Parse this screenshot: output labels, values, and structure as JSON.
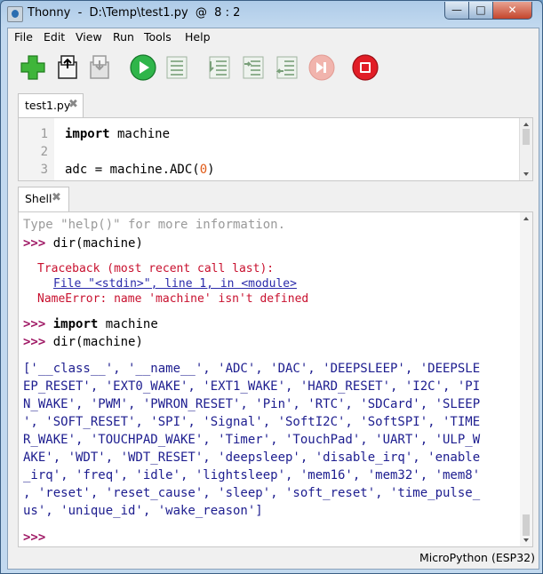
{
  "window": {
    "title": "Thonny  -  D:\\Temp\\test1.py  @  8 : 2"
  },
  "menu": [
    "File",
    "Edit",
    "View",
    "Run",
    "Tools",
    "Help"
  ],
  "toolbar": {
    "buttons": [
      "new-file",
      "open-file",
      "save-file",
      "run",
      "debug",
      "step-over",
      "step-into",
      "step-out",
      "resume",
      "stop"
    ]
  },
  "editor": {
    "tab": "test1.py",
    "lines": [
      {
        "n": "1",
        "kw": "import",
        "rest": " machine"
      },
      {
        "n": "2",
        "kw": "",
        "rest": ""
      },
      {
        "n": "3",
        "pre": "adc = machine.ADC(",
        "num": "0",
        "post": ")"
      }
    ]
  },
  "shell": {
    "tab": "Shell",
    "help_line": "Type \"help()\" for more information.",
    "prompt": ">>>",
    "cmd1": " dir(machine)",
    "traceback": "Traceback (most recent call last):",
    "file_line": "File \"<stdin>\", line 1, in <module>",
    "error": "NameError: name 'machine' isn't defined",
    "cmd2_kw": "import",
    "cmd2_rest": " machine",
    "cmd3": " dir(machine)",
    "output": [
      "['__class__', '__name__', 'ADC', 'DAC', 'DEEPSLEEP', 'DEEPSLE",
      "EP_RESET', 'EXT0_WAKE', 'EXT1_WAKE', 'HARD_RESET', 'I2C', 'PI",
      "N_WAKE', 'PWM', 'PWRON_RESET', 'Pin', 'RTC', 'SDCard', 'SLEEP",
      "', 'SOFT_RESET', 'SPI', 'Signal', 'SoftI2C', 'SoftSPI', 'TIME",
      "R_WAKE', 'TOUCHPAD_WAKE', 'Timer', 'TouchPad', 'UART', 'ULP_W",
      "AKE', 'WDT', 'WDT_RESET', 'deepsleep', 'disable_irq', 'enable",
      "_irq', 'freq', 'idle', 'lightsleep', 'mem16', 'mem32', 'mem8'",
      ", 'reset', 'reset_cause', 'sleep', 'soft_reset', 'time_pulse_",
      "us', 'unique_id', 'wake_reason']"
    ]
  },
  "status": {
    "interpreter": "MicroPython (ESP32)"
  }
}
